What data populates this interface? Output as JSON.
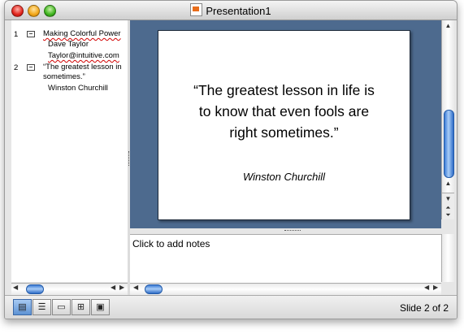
{
  "window": {
    "title": "Presentation1"
  },
  "outline": {
    "slides": [
      {
        "number": "1",
        "title": "Making Colorful Power",
        "lines": [
          "Dave Taylor",
          "Taylor@intuitive.com"
        ]
      },
      {
        "number": "2",
        "title": "“The greatest lesson in",
        "title_cont": "sometimes.”",
        "lines": [
          "Winston Churchill"
        ]
      }
    ]
  },
  "slide": {
    "title_line1": "“The greatest lesson in life is",
    "title_line2": "to know that even fools are",
    "title_line3": "right sometimes.”",
    "subtitle": "Winston Churchill"
  },
  "notes": {
    "placeholder": "Click to add notes"
  },
  "view_buttons": [
    {
      "name": "normal-view",
      "icon": "normal-view-icon",
      "active": true
    },
    {
      "name": "outline-view",
      "icon": "outline-view-icon",
      "active": false
    },
    {
      "name": "slide-view",
      "icon": "slide-view-icon",
      "active": false
    },
    {
      "name": "slide-sorter-view",
      "icon": "slide-sorter-icon",
      "active": false
    },
    {
      "name": "slide-show-view",
      "icon": "slide-show-icon",
      "active": false
    }
  ],
  "status": {
    "slide_indicator": "Slide 2 of 2"
  },
  "colors": {
    "slide_background_area": "#4d6a8e",
    "scroll_thumb": "#3b7bd6"
  }
}
